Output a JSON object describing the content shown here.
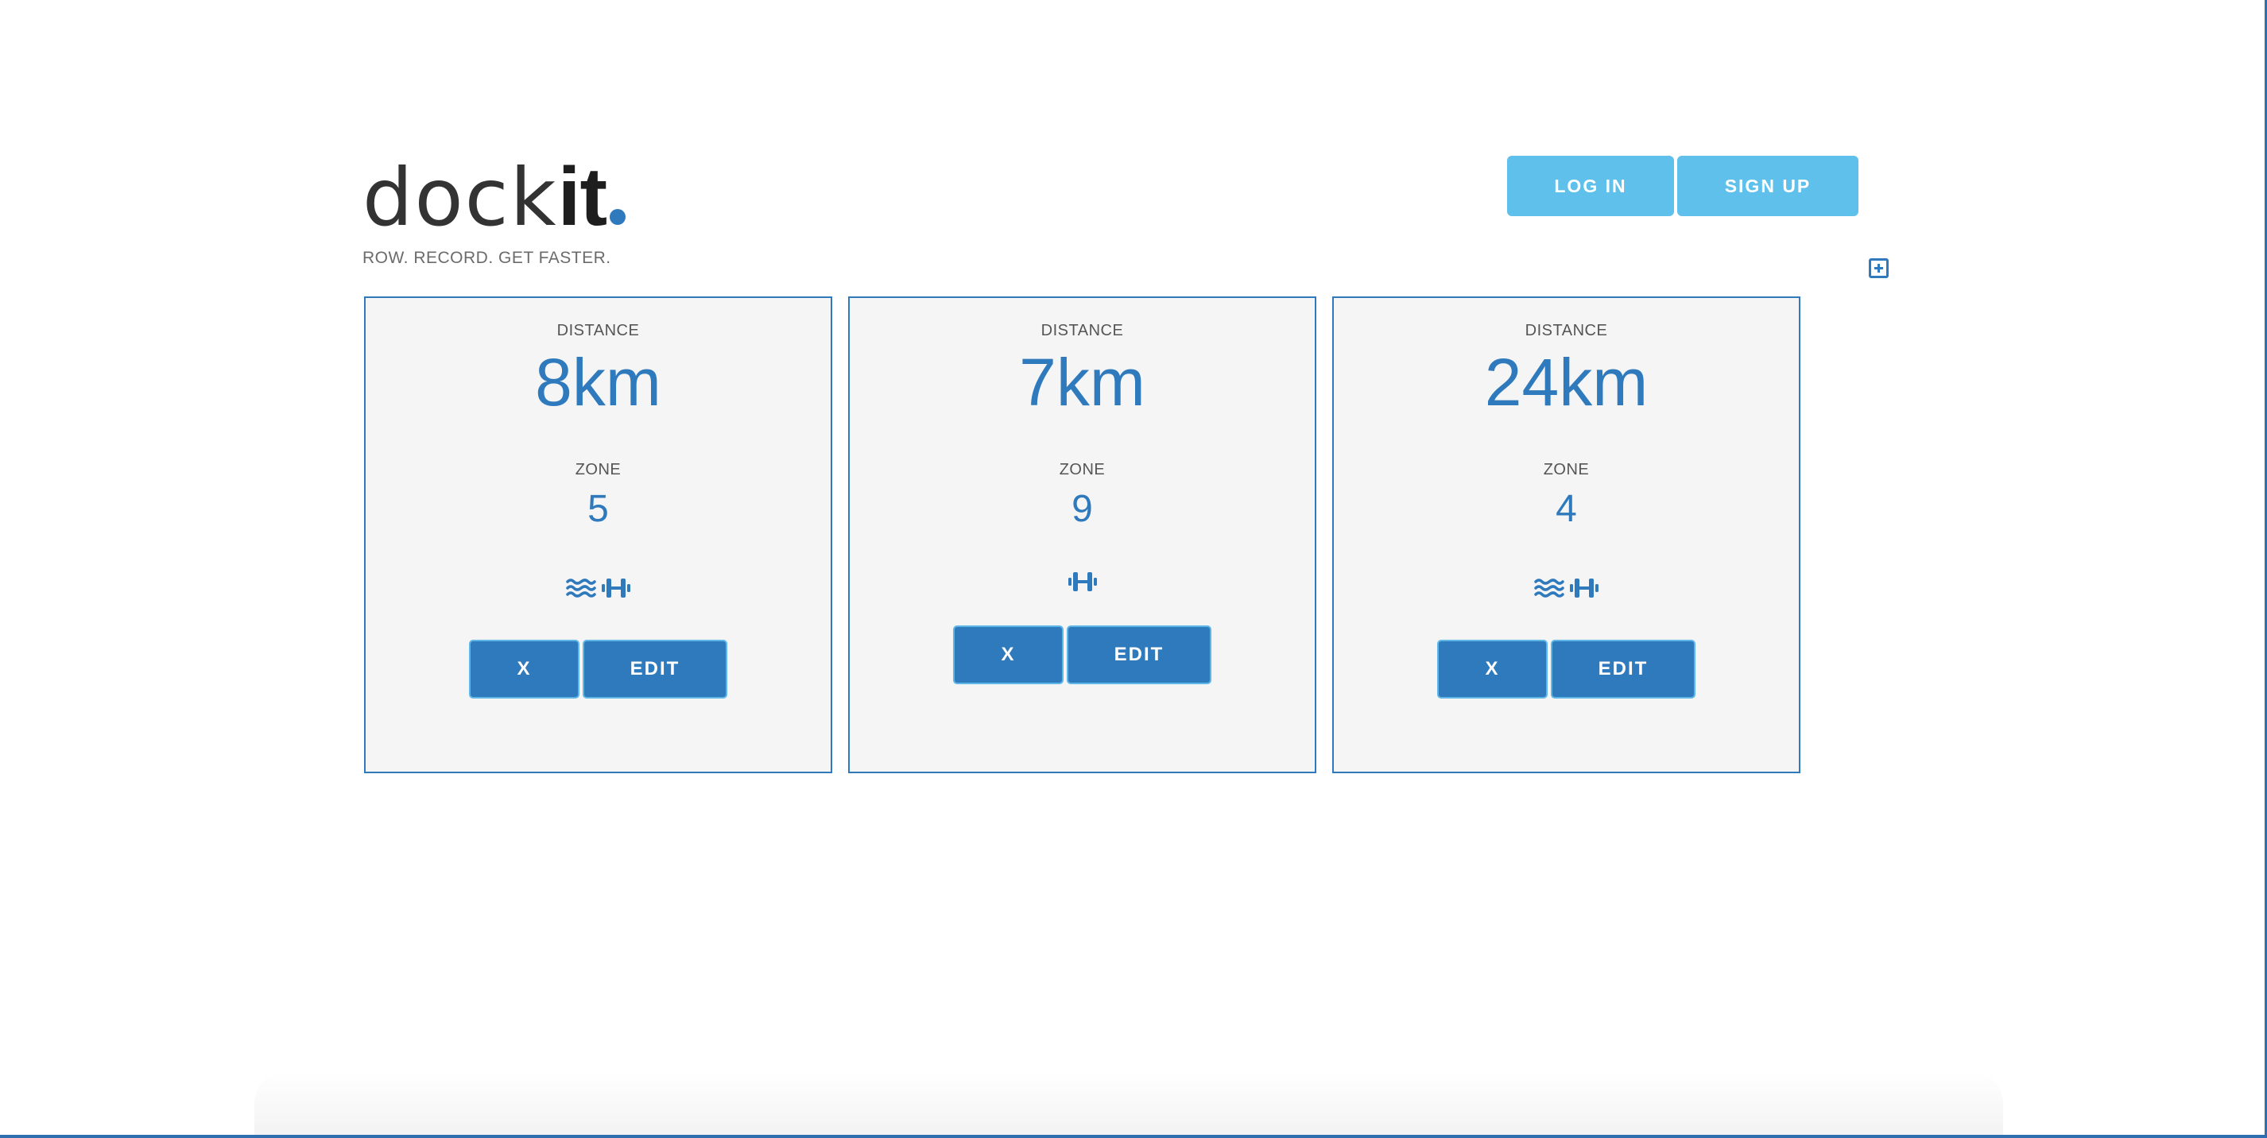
{
  "logo": {
    "light": "dock",
    "bold": "it",
    "tagline": "ROW.  RECORD.  GET FASTER."
  },
  "auth": {
    "login_label": "LOG IN",
    "signup_label": "SIGN UP"
  },
  "add_icon": "plus-square-icon",
  "cards": [
    {
      "distance_label": "DISTANCE",
      "distance": "8km",
      "zone_label": "ZONE",
      "zone": "5",
      "icons": [
        "water-waves-icon",
        "dumbbell-icon"
      ],
      "delete_label": "X",
      "edit_label": "EDIT"
    },
    {
      "distance_label": "DISTANCE",
      "distance": "7km",
      "zone_label": "ZONE",
      "zone": "9",
      "icons": [
        "dumbbell-icon"
      ],
      "delete_label": "X",
      "edit_label": "EDIT"
    },
    {
      "distance_label": "DISTANCE",
      "distance": "24km",
      "zone_label": "ZONE",
      "zone": "4",
      "icons": [
        "water-waves-icon",
        "dumbbell-icon"
      ],
      "delete_label": "X",
      "edit_label": "EDIT"
    }
  ],
  "colors": {
    "accent": "#2f79bd",
    "auth_button": "#5fc0eb",
    "card_background": "#f5f5f5",
    "label_text": "#555555"
  }
}
